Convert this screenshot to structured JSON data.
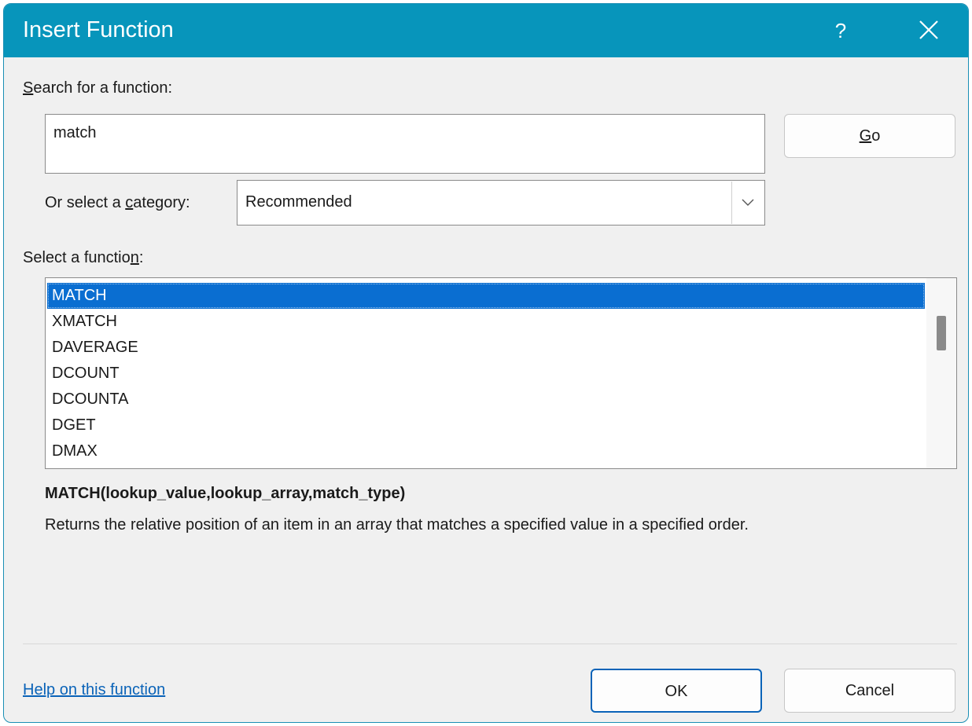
{
  "window": {
    "title": "Insert Function",
    "help_glyph": "?",
    "close_icon": "close-icon"
  },
  "search": {
    "label_mnemonic": "S",
    "label_rest": "earch for a function:",
    "value": "match",
    "go_mnemonic": "G",
    "go_rest": "o"
  },
  "category": {
    "label_pre": "Or select a ",
    "label_mnemonic": "c",
    "label_post": "ategory:",
    "selected": "Recommended"
  },
  "functions": {
    "label_pre": "Select a functio",
    "label_mnemonic": "n",
    "label_post": ":",
    "items": [
      "MATCH",
      "XMATCH",
      "DAVERAGE",
      "DCOUNT",
      "DCOUNTA",
      "DGET",
      "DMAX"
    ],
    "selected_index": 0
  },
  "details": {
    "syntax": "MATCH(lookup_value,lookup_array,match_type)",
    "description": "Returns the relative position of an item in an array that matches a specified value in a specified order."
  },
  "footer": {
    "help_link": "Help on this function",
    "ok_label": "OK",
    "cancel_label": "Cancel"
  },
  "colors": {
    "titlebar": "#0795bb",
    "selection": "#0a6ed1",
    "link": "#0a63b8"
  }
}
